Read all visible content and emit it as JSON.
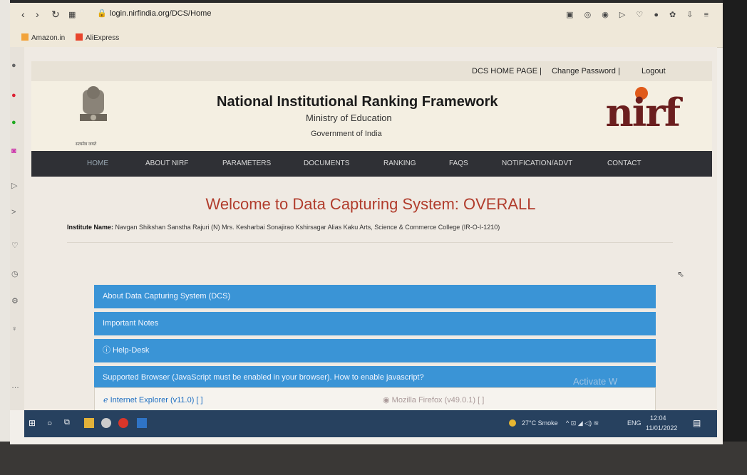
{
  "browser": {
    "url": "login.nirfindia.org/DCS/Home",
    "bookmarks": [
      "Amazon.in",
      "AliExpress"
    ]
  },
  "site": {
    "toplinks": [
      "DCS HOME PAGE |",
      "Change Password |",
      "Logout"
    ],
    "title": "National Institutional Ranking Framework",
    "subtitle": "Ministry of Education",
    "subtitle2": "Government of India",
    "logo_text": "nirf",
    "emblem_caption": "सत्यमेव जयते"
  },
  "nav": {
    "items": [
      "HOME",
      "ABOUT NIRF",
      "PARAMETERS",
      "DOCUMENTS",
      "RANKING",
      "FAQS",
      "NOTIFICATION/ADVT",
      "CONTACT"
    ]
  },
  "main": {
    "welcome": "Welcome to Data Capturing System: OVERALL",
    "institute_label": "Institute Name:",
    "institute_value": "Navgan Shikshan Sanstha Rajuri (N) Mrs. Kesharbai Sonajirao Kshirsagar Alias Kaku Arts, Science & Commerce College (IR-O-I-1210)",
    "panels": [
      "About Data Capturing System (DCS)",
      "Important Notes",
      "ⓘ Help-Desk",
      "Supported Browser (JavaScript must be enabled in your browser). How to enable javascript?"
    ],
    "browsers": [
      "Internet Explorer (v11.0)  [  ]",
      "Mozilla Firefox (v49.0.1)  [  ]"
    ],
    "watermark": "Activate W"
  },
  "taskbar": {
    "weather": "27°C Smoke",
    "lang": "ENG",
    "time": "12:04",
    "date": "11/01/2022"
  },
  "colors": {
    "panel": "#3a94d6",
    "navbar": "#2f3035",
    "welcome": "#b13c2c",
    "logo": "#6b1f1f"
  }
}
